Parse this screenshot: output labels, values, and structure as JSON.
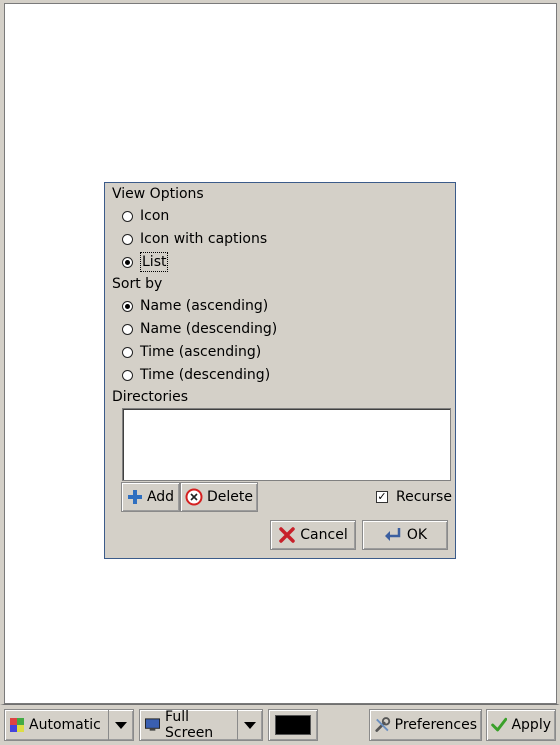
{
  "dialog": {
    "view_options_label": "View Options",
    "view_options": [
      {
        "label": "Icon",
        "selected": false
      },
      {
        "label": "Icon with captions",
        "selected": false
      },
      {
        "label": "List",
        "selected": true
      }
    ],
    "sort_by_label": "Sort by",
    "sort_options": [
      {
        "label": "Name (ascending)",
        "selected": true
      },
      {
        "label": "Name (descending)",
        "selected": false
      },
      {
        "label": "Time (ascending)",
        "selected": false
      },
      {
        "label": "Time (descending)",
        "selected": false
      }
    ],
    "directories_label": "Directories",
    "add_label": "Add",
    "delete_label": "Delete",
    "recurse_label": "Recurse",
    "recurse_checked": true,
    "cancel_label": "Cancel",
    "ok_label": "OK"
  },
  "taskbar": {
    "mode_value": "Automatic",
    "screen_value": "Full Screen",
    "color_value": "#000000",
    "preferences_label": "Preferences",
    "apply_label": "Apply"
  },
  "colors": {
    "dialog_border": "#3b5b8a",
    "panel_bg": "#d4d0c8",
    "delete_icon": "#d42020",
    "cancel_icon": "#c8202a",
    "apply_icon": "#3aa02a",
    "add_icon": "#2f6fc0"
  },
  "icons": {
    "add": "plus-icon",
    "delete": "delete-circle-icon",
    "cancel": "cancel-x-icon",
    "ok": "enter-arrow-icon",
    "preferences": "tools-icon",
    "apply": "checkmark-icon",
    "mode": "display-mode-icon",
    "screen": "monitor-icon"
  }
}
